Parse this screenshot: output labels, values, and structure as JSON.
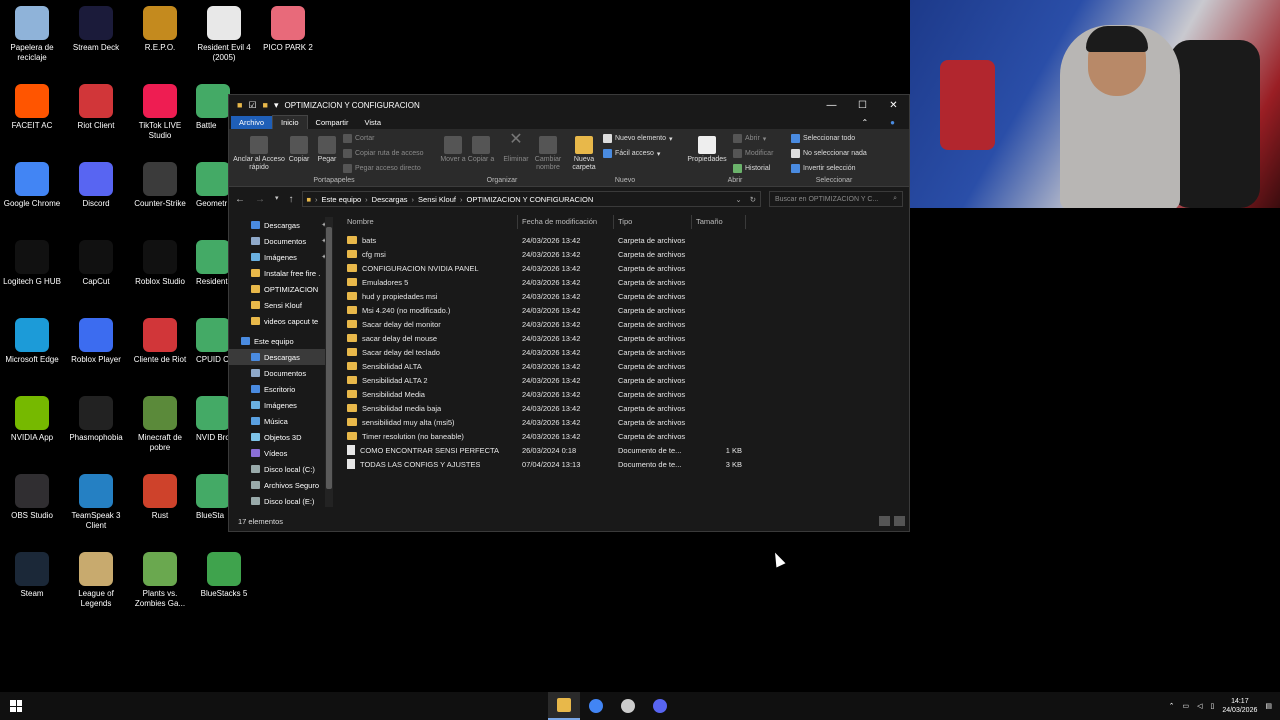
{
  "desktop_icons": [
    {
      "label": "Papelera de reciclaje",
      "icon": "recycle-bin-icon",
      "color": "#8fb3d9"
    },
    {
      "label": "Stream Deck",
      "icon": "stream-deck-icon",
      "color": "#1b1b3a"
    },
    {
      "label": "R.E.P.O.",
      "icon": "repo-game-icon",
      "color": "#c48a1e"
    },
    {
      "label": "Resident Evil 4 (2005)",
      "icon": "resident-evil-icon",
      "color": "#e8e8e8"
    },
    {
      "label": "PICO PARK 2",
      "icon": "pico-park-icon",
      "color": "#e86a7a"
    },
    {
      "label": "FACEIT AC",
      "icon": "faceit-icon",
      "color": "#ff5500"
    },
    {
      "label": "Riot Client",
      "icon": "riot-icon",
      "color": "#d13639"
    },
    {
      "label": "TikTok LIVE Studio",
      "icon": "tiktok-icon",
      "color": "#ee1d52"
    },
    {
      "label": "Google Chrome",
      "icon": "chrome-icon",
      "color": "#4285f4"
    },
    {
      "label": "Discord",
      "icon": "discord-icon",
      "color": "#5865f2"
    },
    {
      "label": "Counter-Strike",
      "icon": "counter-strike-icon",
      "color": "#3b3b3b"
    },
    {
      "label": "Logitech G HUB",
      "icon": "logitech-icon",
      "color": "#111111"
    },
    {
      "label": "CapCut",
      "icon": "capcut-icon",
      "color": "#111111"
    },
    {
      "label": "Roblox Studio",
      "icon": "roblox-studio-icon",
      "color": "#111111"
    },
    {
      "label": "Microsoft Edge",
      "icon": "edge-icon",
      "color": "#1c9bd8"
    },
    {
      "label": "Roblox Player",
      "icon": "roblox-player-icon",
      "color": "#3c6cf0"
    },
    {
      "label": "Cliente de Riot",
      "icon": "riot-client-icon",
      "color": "#d13639"
    },
    {
      "label": "NVIDIA App",
      "icon": "nvidia-icon",
      "color": "#76b900"
    },
    {
      "label": "Phasmophobia",
      "icon": "phasmophobia-icon",
      "color": "#222222"
    },
    {
      "label": "Minecraft de pobre",
      "icon": "minecraft-icon",
      "color": "#5b8a3a"
    },
    {
      "label": "OBS Studio",
      "icon": "obs-icon",
      "color": "#302e31"
    },
    {
      "label": "TeamSpeak 3 Client",
      "icon": "teamspeak-icon",
      "color": "#2580c3"
    },
    {
      "label": "Rust",
      "icon": "rust-icon",
      "color": "#ce422b"
    },
    {
      "label": "Steam",
      "icon": "steam-icon",
      "color": "#1b2838"
    },
    {
      "label": "League of Legends",
      "icon": "league-icon",
      "color": "#c8aa6e"
    },
    {
      "label": "Plants vs. Zombies Ga...",
      "icon": "pvz-icon",
      "color": "#6aa84f"
    },
    {
      "label": "BlueStacks 5",
      "icon": "bluestacks-icon",
      "color": "#3fa34d"
    }
  ],
  "partially_hidden_labels": [
    "Battle",
    "Geometr",
    "Resident",
    "CPUID C",
    "NVID Broad",
    "BlueSta"
  ],
  "window": {
    "title": "OPTIMIZACION Y CONFIGURACION",
    "tabs": {
      "file": "Archivo",
      "home": "Inicio",
      "share": "Compartir",
      "view": "Vista"
    },
    "ribbon": {
      "pin": "Anclar al Acceso rápido",
      "copy": "Copiar",
      "paste": "Pegar",
      "cut": "Cortar",
      "copy_path": "Copiar ruta de acceso",
      "paste_shortcut": "Pegar acceso directo",
      "group_clipboard": "Portapapeles",
      "move_to": "Mover a",
      "copy_to": "Copiar a",
      "delete": "Eliminar",
      "rename": "Cambiar nombre",
      "group_organize": "Organizar",
      "new_folder": "Nueva carpeta",
      "new_item": "Nuevo elemento",
      "easy_access": "Fácil acceso",
      "group_new": "Nuevo",
      "properties": "Propiedades",
      "open": "Abrir",
      "edit": "Modificar",
      "history": "Historial",
      "group_open": "Abrir",
      "select_all": "Seleccionar todo",
      "select_none": "No seleccionar nada",
      "invert": "Invertir selección",
      "group_select": "Seleccionar"
    },
    "breadcrumb": [
      "Este equipo",
      "Descargas",
      "Sensi Klouf",
      "OPTIMIZACION Y CONFIGURACION"
    ],
    "search_placeholder": "Buscar en OPTIMIZACION Y C...",
    "nav": [
      {
        "label": "Descargas",
        "type": "download",
        "pin": true
      },
      {
        "label": "Documentos",
        "type": "doc",
        "pin": true
      },
      {
        "label": "Imágenes",
        "type": "img",
        "pin": true
      },
      {
        "label": "Instalar free fire .",
        "type": "folder",
        "pin": false
      },
      {
        "label": "OPTIMIZACION",
        "type": "folder",
        "pin": false
      },
      {
        "label": "Sensi Klouf",
        "type": "folder",
        "pin": false
      },
      {
        "label": "videos capcut te",
        "type": "folder",
        "pin": false
      },
      {
        "label": "Este equipo",
        "type": "pc",
        "pin": false,
        "section": true
      },
      {
        "label": "Descargas",
        "type": "download",
        "pin": false,
        "selected": true
      },
      {
        "label": "Documentos",
        "type": "doc",
        "pin": false
      },
      {
        "label": "Escritorio",
        "type": "desk",
        "pin": false
      },
      {
        "label": "Imágenes",
        "type": "img",
        "pin": false
      },
      {
        "label": "Música",
        "type": "music",
        "pin": false
      },
      {
        "label": "Objetos 3D",
        "type": "obj",
        "pin": false
      },
      {
        "label": "Vídeos",
        "type": "video",
        "pin": false
      },
      {
        "label": "Disco local (C:)",
        "type": "disk",
        "pin": false
      },
      {
        "label": "Archivos Seguro",
        "type": "disk",
        "pin": false
      },
      {
        "label": "Disco local (E:)",
        "type": "disk",
        "pin": false
      }
    ],
    "columns": {
      "name": "Nombre",
      "date": "Fecha de modificación",
      "type": "Tipo",
      "size": "Tamaño"
    },
    "files": [
      {
        "name": "bats",
        "date": "24/03/2026 13:42",
        "type": "Carpeta de archivos",
        "size": "",
        "kind": "folder"
      },
      {
        "name": "cfg msi",
        "date": "24/03/2026 13:42",
        "type": "Carpeta de archivos",
        "size": "",
        "kind": "folder"
      },
      {
        "name": "CONFIGURACION NVIDIA PANEL",
        "date": "24/03/2026 13:42",
        "type": "Carpeta de archivos",
        "size": "",
        "kind": "folder"
      },
      {
        "name": "Emuladores 5",
        "date": "24/03/2026 13:42",
        "type": "Carpeta de archivos",
        "size": "",
        "kind": "folder"
      },
      {
        "name": "hud y propiedades msi",
        "date": "24/03/2026 13:42",
        "type": "Carpeta de archivos",
        "size": "",
        "kind": "folder"
      },
      {
        "name": "Msi 4.240 (no modificado.)",
        "date": "24/03/2026 13:42",
        "type": "Carpeta de archivos",
        "size": "",
        "kind": "folder"
      },
      {
        "name": "Sacar delay del monitor",
        "date": "24/03/2026 13:42",
        "type": "Carpeta de archivos",
        "size": "",
        "kind": "folder"
      },
      {
        "name": "sacar delay del mouse",
        "date": "24/03/2026 13:42",
        "type": "Carpeta de archivos",
        "size": "",
        "kind": "folder"
      },
      {
        "name": "Sacar delay del teclado",
        "date": "24/03/2026 13:42",
        "type": "Carpeta de archivos",
        "size": "",
        "kind": "folder"
      },
      {
        "name": "Sensibilidad ALTA",
        "date": "24/03/2026 13:42",
        "type": "Carpeta de archivos",
        "size": "",
        "kind": "folder"
      },
      {
        "name": "Sensibilidad ALTA 2",
        "date": "24/03/2026 13:42",
        "type": "Carpeta de archivos",
        "size": "",
        "kind": "folder"
      },
      {
        "name": "Sensibilidad Media",
        "date": "24/03/2026 13:42",
        "type": "Carpeta de archivos",
        "size": "",
        "kind": "folder"
      },
      {
        "name": "Sensibilidad media baja",
        "date": "24/03/2026 13:42",
        "type": "Carpeta de archivos",
        "size": "",
        "kind": "folder"
      },
      {
        "name": "sensibilidad muy alta (msi5)",
        "date": "24/03/2026 13:42",
        "type": "Carpeta de archivos",
        "size": "",
        "kind": "folder"
      },
      {
        "name": "Timer resolution (no baneable)",
        "date": "24/03/2026 13:42",
        "type": "Carpeta de archivos",
        "size": "",
        "kind": "folder"
      },
      {
        "name": "COMO ENCONTRAR SENSI PERFECTA",
        "date": "26/03/2024 0:18",
        "type": "Documento de te...",
        "size": "1 KB",
        "kind": "doc"
      },
      {
        "name": "TODAS LAS CONFIGS Y AJUSTES",
        "date": "07/04/2024 13:13",
        "type": "Documento de te...",
        "size": "3 KB",
        "kind": "doc"
      }
    ],
    "status": "17 elementos"
  },
  "taskbar": {
    "apps": [
      {
        "name": "file-explorer",
        "color": "#e8b84a",
        "active": true
      },
      {
        "name": "chrome",
        "color": "#4285f4",
        "active": false
      },
      {
        "name": "obs",
        "color": "#cccccc",
        "active": false
      },
      {
        "name": "discord-alt",
        "color": "#5865f2",
        "active": false
      }
    ],
    "time": "14:17",
    "date": "24/03/2026"
  }
}
